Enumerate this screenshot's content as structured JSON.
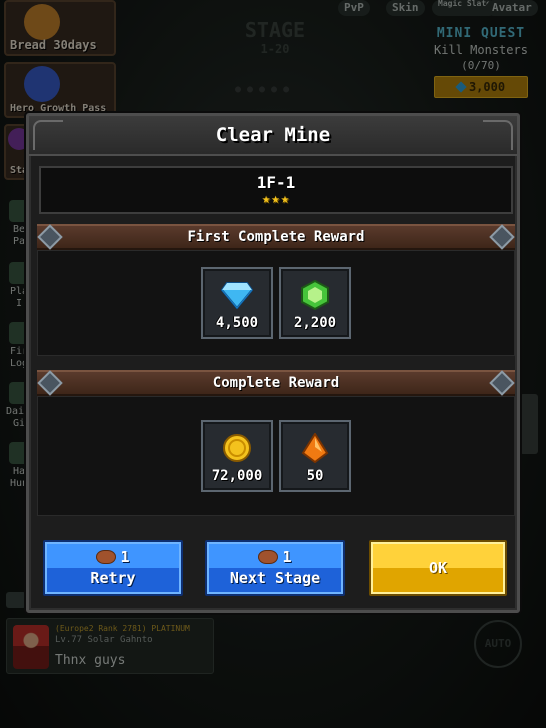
{
  "background": {
    "stage_title": "STAGE",
    "stage_range": "1-20",
    "side_tiles": [
      {
        "label": "Bread 30days"
      },
      {
        "label": "Hero Growth Pass"
      },
      {
        "label": "Stag"
      }
    ],
    "side_small": [
      "Be Pa",
      "Pla I",
      "Fir Log",
      "Daily Gi",
      "Ha Hun"
    ],
    "top_buttons": [
      "PvP",
      "Skin",
      "Magic Slate",
      "Avatar"
    ],
    "mini_quest": {
      "title": "MINI QUEST",
      "task": "Kill Monsters",
      "progress": "(0/70)",
      "reward": "3,000"
    },
    "chat": {
      "rank_line": "(Europe2 Rank 2781) PLATINUM",
      "name_line": "Lv.77 Solar Gahnto",
      "message": "Thnx guys"
    },
    "auto_label": "AUTO"
  },
  "dialog": {
    "title": "Clear Mine",
    "stage": "1F-1",
    "stars": "★★★",
    "first_reward": {
      "heading": "First Complete Reward",
      "items": [
        {
          "icon": "blue-diamond-icon",
          "amount": "4,500"
        },
        {
          "icon": "green-gem-icon",
          "amount": "2,200"
        }
      ]
    },
    "complete_reward": {
      "heading": "Complete Reward",
      "items": [
        {
          "icon": "gold-coin-icon",
          "amount": "72,000"
        },
        {
          "icon": "orange-crystal-icon",
          "amount": "50"
        }
      ]
    },
    "buttons": {
      "retry": {
        "cost": "1",
        "label": "Retry"
      },
      "next": {
        "cost": "1",
        "label": "Next Stage"
      },
      "ok": {
        "label": "OK"
      }
    }
  },
  "colors": {
    "accent_blue": "#1e62d9",
    "accent_gold": "#e0a500",
    "star": "#f2c11c",
    "quest_title": "#5ac0d8"
  }
}
